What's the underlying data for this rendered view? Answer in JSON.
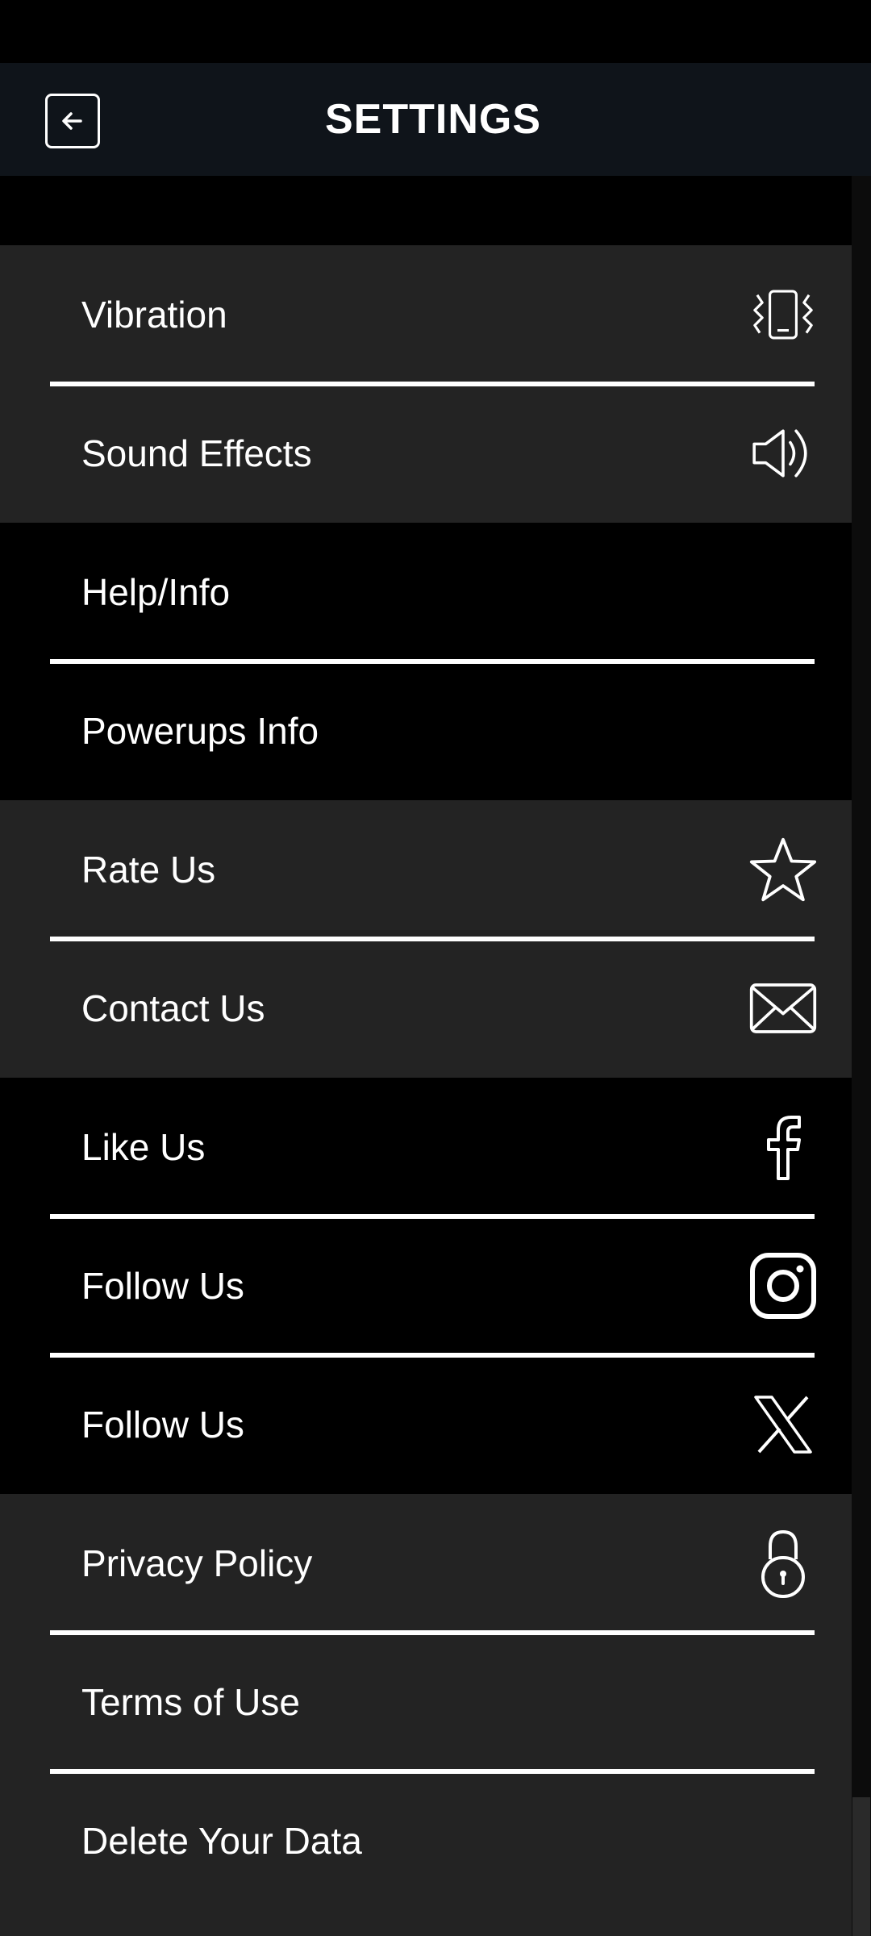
{
  "header": {
    "title": "SETTINGS",
    "back_icon": "arrow-left-icon"
  },
  "colors": {
    "gray_row": "#232323",
    "black_row": "#000000",
    "header_bg": "#0f141a",
    "text": "#ffffff"
  },
  "groups": [
    {
      "style": "gray",
      "items": [
        {
          "label": "Vibration",
          "icon": "vibration-icon"
        },
        {
          "label": "Sound Effects",
          "icon": "speaker-icon"
        }
      ]
    },
    {
      "style": "black",
      "items": [
        {
          "label": "Help/Info",
          "icon": ""
        },
        {
          "label": "Powerups Info",
          "icon": ""
        }
      ]
    },
    {
      "style": "gray",
      "items": [
        {
          "label": "Rate Us",
          "icon": "star-icon"
        },
        {
          "label": "Contact Us",
          "icon": "mail-icon"
        }
      ]
    },
    {
      "style": "black",
      "items": [
        {
          "label": "Like Us",
          "icon": "facebook-icon"
        },
        {
          "label": "Follow Us",
          "icon": "instagram-icon"
        },
        {
          "label": "Follow Us",
          "icon": "x-icon"
        }
      ]
    },
    {
      "style": "gray",
      "items": [
        {
          "label": "Privacy Policy",
          "icon": "lock-icon"
        },
        {
          "label": "Terms of Use",
          "icon": ""
        },
        {
          "label": "Delete Your Data",
          "icon": ""
        }
      ]
    }
  ]
}
